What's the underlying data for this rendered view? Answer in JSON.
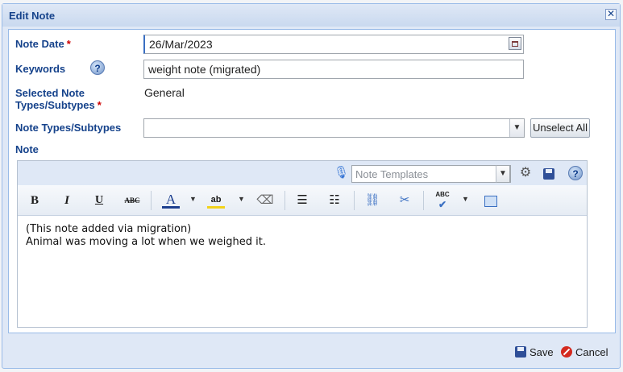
{
  "dialog": {
    "title": "Edit Note",
    "close_symbol": "✕"
  },
  "form": {
    "note_date_label": "Note Date",
    "note_date_value": "26/Mar/2023",
    "keywords_label": "Keywords",
    "keywords_value": "weight note (migrated)",
    "selected_types_label_line1": "Selected Note",
    "selected_types_label_line2": "Types/Subtypes",
    "selected_types_value": "General",
    "note_types_label": "Note Types/Subtypes",
    "note_types_value": "",
    "unselect_all_label": "Unselect All",
    "note_label": "Note",
    "required_mark": "*"
  },
  "editor": {
    "templates_placeholder": "Note Templates",
    "toolbar_icons": [
      "microphone-icon",
      "gear-icon",
      "save-icon",
      "help-icon",
      "bold-icon",
      "italic-icon",
      "underline-icon",
      "strikethrough-icon",
      "font-color-icon",
      "highlight-icon",
      "eraser-icon",
      "bullet-list-icon",
      "numbered-list-icon",
      "link-icon",
      "unlink-icon",
      "spellcheck-icon",
      "source-icon"
    ],
    "bold_glyph": "B",
    "italic_glyph": "I",
    "underline_glyph": "U",
    "strike_glyph": "ABC",
    "font_color_glyph": "A",
    "highlight_glyph": "ab",
    "spellcheck_glyph": "ABC",
    "content_lines": [
      "(This note added via migration)",
      "Animal was moving a lot when we weighed it."
    ]
  },
  "footer": {
    "save_label": "Save",
    "cancel_label": "Cancel"
  },
  "colors": {
    "label_blue": "#15428b",
    "required_red": "#cc0000",
    "panel_bg": "#dfe8f6"
  }
}
